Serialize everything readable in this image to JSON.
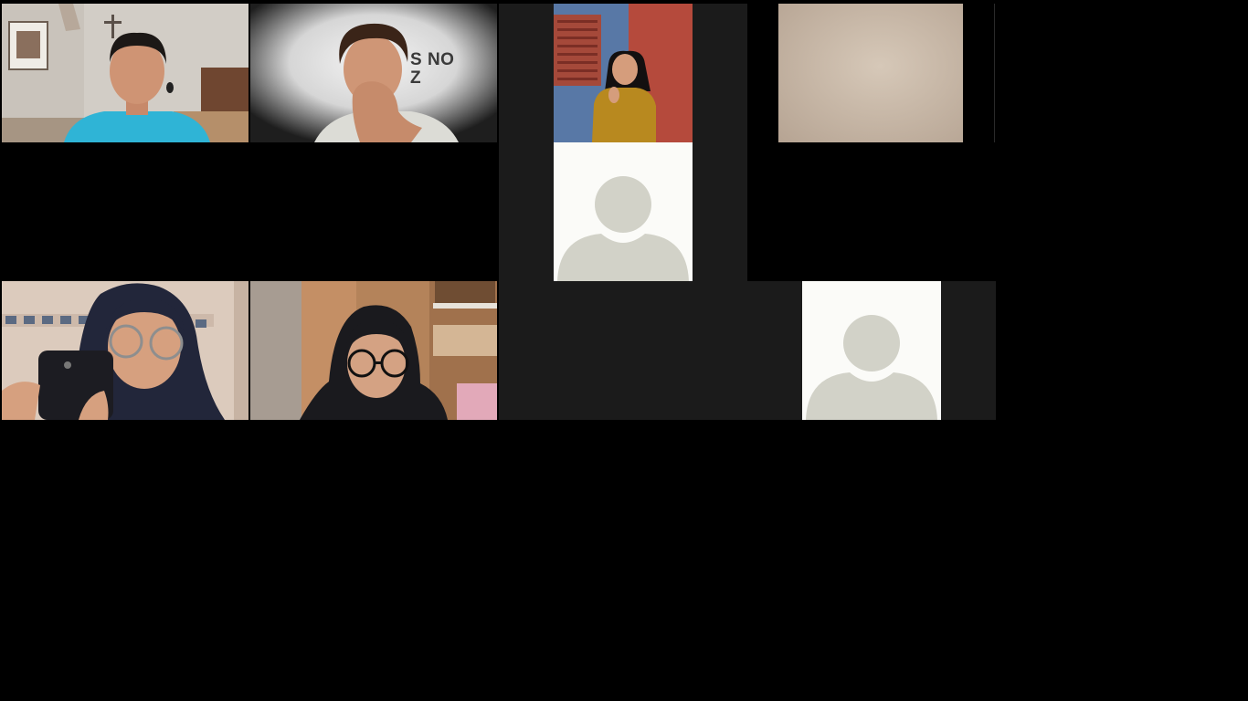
{
  "meeting": {
    "view": "gallery",
    "tile_count": 8
  },
  "participants": [
    {
      "id": "p1",
      "video": "on",
      "bg_colors": [
        "#cfc9c2",
        "#2fb4d6"
      ]
    },
    {
      "id": "p2",
      "video": "on",
      "virtual_background_text": "S NO\nZ",
      "bg_colors": [
        "#e8e8e8",
        "#202020"
      ]
    },
    {
      "id": "p3",
      "video": "on",
      "bg_colors": [
        "#5878a6",
        "#b54a3c",
        "#b8891f"
      ]
    },
    {
      "id": "p4",
      "video": "on",
      "bg_colors": [
        "#c8b8a6"
      ]
    },
    {
      "id": "p5",
      "video": "off",
      "avatar": "default-avatar-icon"
    },
    {
      "id": "p6",
      "video": "on",
      "bg_colors": [
        "#d9c7b8",
        "#22263a"
      ]
    },
    {
      "id": "p7",
      "video": "on",
      "bg_colors": [
        "#b4835a",
        "#1a1a1e"
      ]
    },
    {
      "id": "p8",
      "video": "off",
      "avatar": "default-avatar-icon"
    }
  ],
  "colors": {
    "background": "#000000",
    "tile_frame": "#1b1b1b",
    "avatar_bg": "#fbfbf8",
    "avatar_figure": "#d2d2c8"
  }
}
